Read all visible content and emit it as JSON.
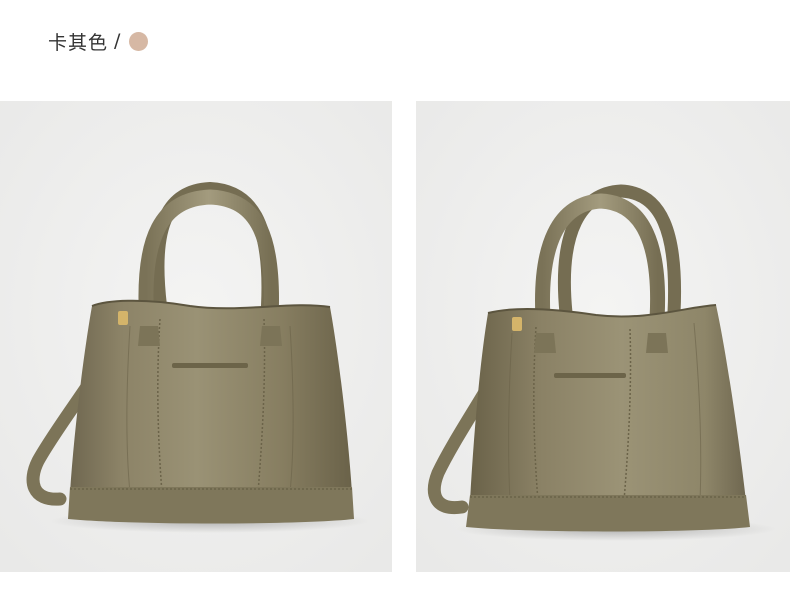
{
  "header": {
    "color_name": "卡其色",
    "separator": "/",
    "swatch_color": "#d6b8a4"
  },
  "photos": [
    {
      "name": "product-photo-front",
      "background": "#efefef",
      "bag_color": "#8a8063"
    },
    {
      "name": "product-photo-angle",
      "background": "#efefef",
      "bag_color": "#8a8063"
    }
  ]
}
